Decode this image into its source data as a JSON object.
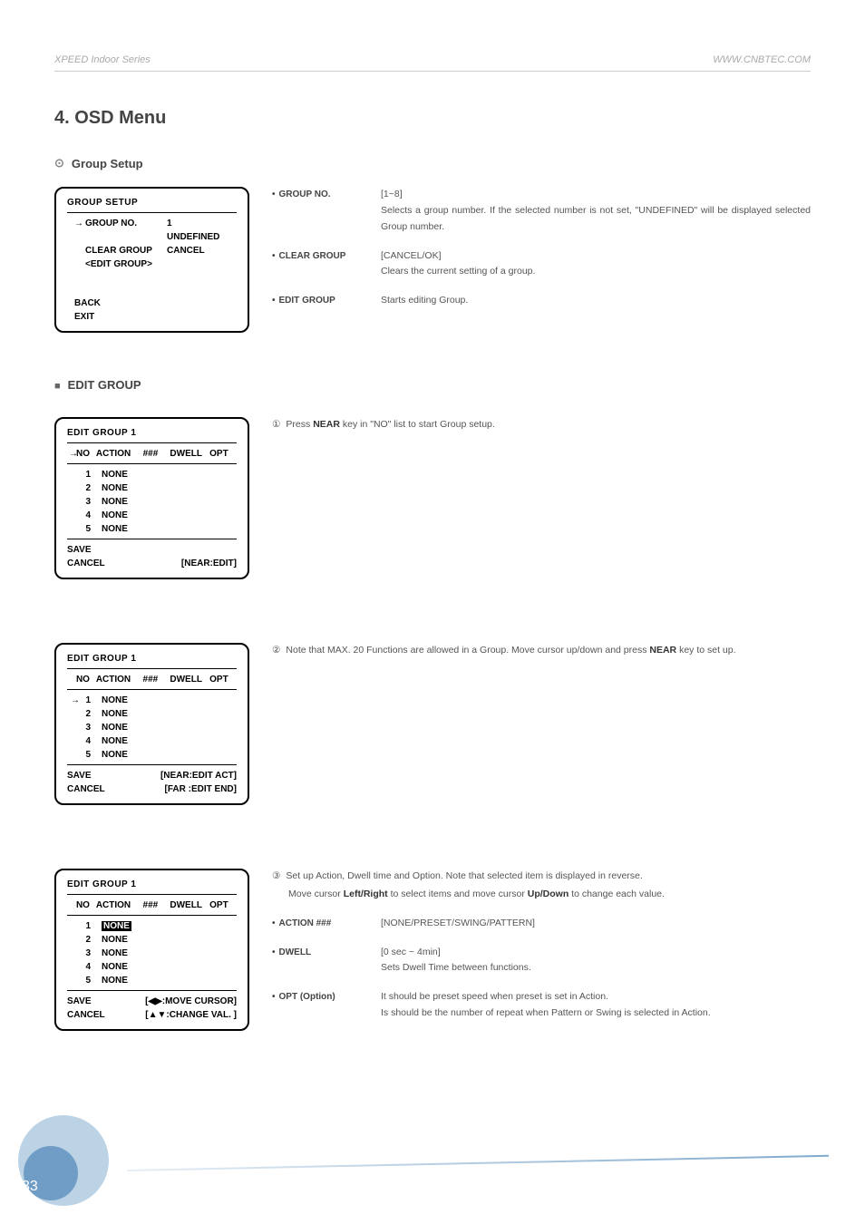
{
  "header": {
    "left": "XPEED Indoor Series",
    "right": "WWW.CNBTEC.COM"
  },
  "chapter": "4. OSD Menu",
  "group_setup_title": "Group Setup",
  "osd1": {
    "title": "GROUP SETUP",
    "rows": [
      {
        "arrow": "→",
        "label": "GROUP NO.",
        "val": "1"
      },
      {
        "arrow": "",
        "label": "",
        "val": "UNDEFINED"
      },
      {
        "arrow": "",
        "label": "CLEAR GROUP",
        "val": "CANCEL"
      },
      {
        "arrow": "",
        "label": "<EDIT GROUP>",
        "val": ""
      }
    ],
    "footer": [
      "BACK",
      "EXIT"
    ]
  },
  "desc1": {
    "group_no": {
      "label": "GROUP NO.",
      "range": "[1~8]",
      "text": "Selects a group number. If the selected number is not set, \"UNDEFINED\" will be displayed selected Group number."
    },
    "clear": {
      "label": "CLEAR GROUP",
      "range": "[CANCEL/OK]",
      "text": "Clears the current setting of a group."
    },
    "edit": {
      "label": "EDIT GROUP",
      "text": "Starts editing Group."
    }
  },
  "edit_group_title": "EDIT GROUP",
  "osd_eg_title": "EDIT GROUP 1",
  "osd_eg_headers": {
    "arrow": "→",
    "no": "NO",
    "action": "ACTION",
    "hash": "###",
    "dwell": "DWELL",
    "opt": "OPT"
  },
  "osd_eg_rows": [
    {
      "no": "1",
      "action": "NONE"
    },
    {
      "no": "2",
      "action": "NONE"
    },
    {
      "no": "3",
      "action": "NONE"
    },
    {
      "no": "4",
      "action": "NONE"
    },
    {
      "no": "5",
      "action": "NONE"
    }
  ],
  "osd2_footer_left": [
    "SAVE",
    "CANCEL"
  ],
  "osd2_footer_right": "[NEAR:EDIT]",
  "osd3_footer_right": [
    "[NEAR:EDIT ACT]",
    "[FAR  :EDIT END]"
  ],
  "osd4_footer_right": [
    "[◀▶:MOVE CURSOR]",
    "[▲▼:CHANGE VAL. ]"
  ],
  "step1": {
    "num": "①",
    "text_a": "Press ",
    "key": "NEAR",
    "text_b": " key in \"NO\" list to start Group setup."
  },
  "step2": {
    "num": "②",
    "text_a": "Note that MAX. 20 Functions are allowed in a Group. Move cursor up/down and press ",
    "key": "NEAR",
    "text_b": " key to set up."
  },
  "step3": {
    "num": "③",
    "line1_a": "Set up Action, Dwell time and Option. Note that selected item is displayed in reverse.",
    "line2_a": "Move cursor ",
    "k1": "Left/Right",
    "line2_b": " to select items and move cursor ",
    "k2": "Up/Down",
    "line2_c": " to change each value."
  },
  "desc3": {
    "action": {
      "label": "ACTION ###",
      "range": "[NONE/PRESET/SWING/PATTERN]"
    },
    "dwell": {
      "label": "DWELL",
      "range": "[0 sec ~ 4min]",
      "text": "Sets Dwell Time between functions."
    },
    "opt": {
      "label": "OPT (Option)",
      "text1": "It should be preset speed when preset is set in Action.",
      "text2": "Is should be the number of repeat when Pattern or Swing is selected in Action."
    }
  },
  "page_number": "33"
}
